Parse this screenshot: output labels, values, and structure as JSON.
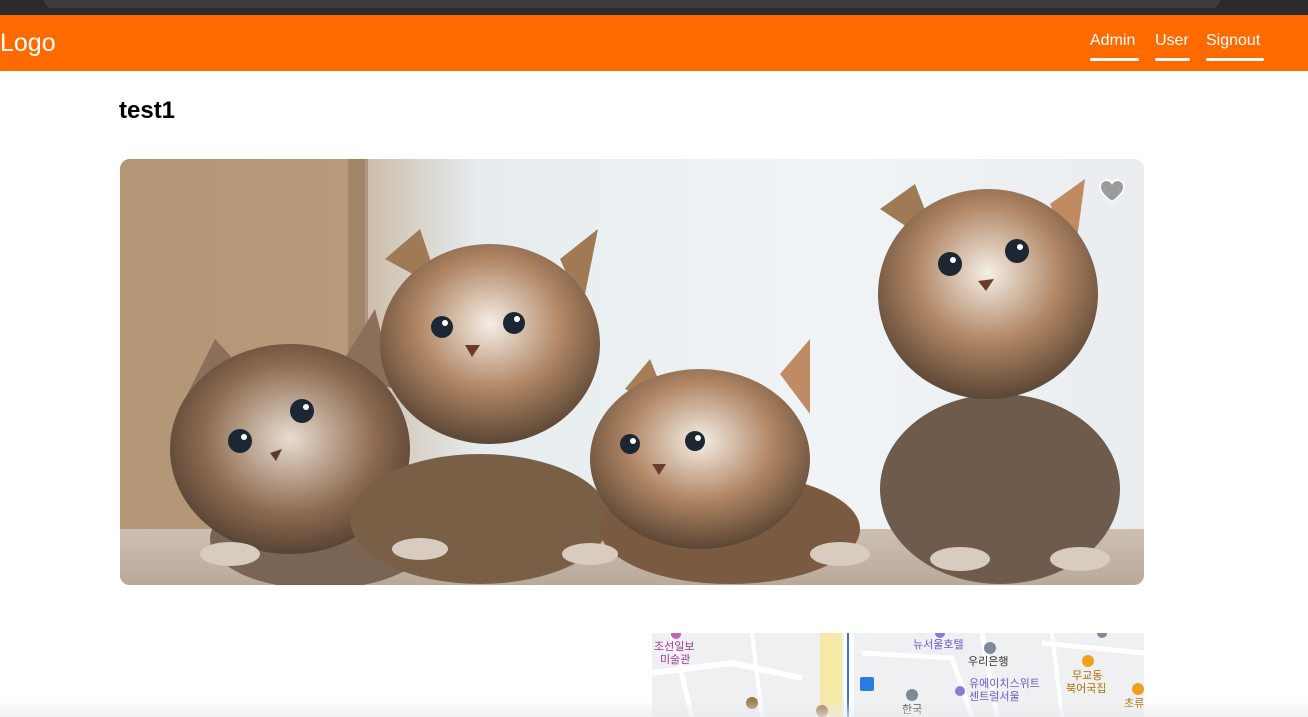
{
  "navbar": {
    "logo": "Logo",
    "links": [
      "Admin",
      "User",
      "Signout"
    ],
    "background": "#ff6a00"
  },
  "post": {
    "title": "test1",
    "image_alt": "four tabby kittens",
    "favorite_icon": "heart-icon"
  },
  "map": {
    "labels": [
      "조선일보",
      "미술관",
      "뉴서울호텔",
      "우리은행",
      "유에이치스위트",
      "센트럴서울",
      "무교동",
      "북어국집",
      "한국",
      "초류"
    ]
  }
}
